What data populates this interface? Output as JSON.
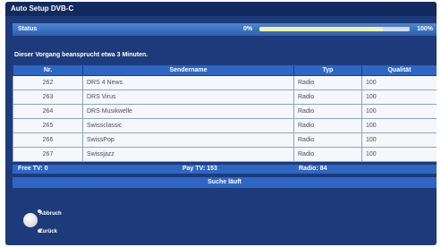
{
  "window": {
    "title": "Auto Setup DVB-C"
  },
  "status": {
    "label": "Status",
    "min_label": "0%",
    "max_label": "100%",
    "progress_fraction": 0.82
  },
  "notice": "Dieser Vorgang beansprucht etwa 3 Minuten.",
  "table": {
    "headers": [
      "Nr.",
      "Sendername",
      "Typ",
      "Qualität"
    ],
    "rows": [
      {
        "nr": "262",
        "name": "DRS 4 News",
        "type": "Radio",
        "quality": "100"
      },
      {
        "nr": "263",
        "name": "DRS Virus",
        "type": "Radio",
        "quality": "100"
      },
      {
        "nr": "264",
        "name": "DRS Musikwelle",
        "type": "Radio",
        "quality": "100"
      },
      {
        "nr": "265",
        "name": "Swissclassic",
        "type": "Radio",
        "quality": "100"
      },
      {
        "nr": "266",
        "name": "SwissPop",
        "type": "Radio",
        "quality": "100"
      },
      {
        "nr": "267",
        "name": "Swissjazz",
        "type": "Radio",
        "quality": "100"
      }
    ]
  },
  "summary": {
    "free_tv": "Free TV: 0",
    "pay_tv": "Pay TV: 153",
    "radio": "Radio: 84"
  },
  "search_status": "Suche läuft",
  "remote_hints": {
    "cancel": "Abbruch",
    "back": "Zurück"
  },
  "colors": {
    "background": "#1d3a7a",
    "accent": "#2f66c2",
    "row_background": "#f6f7fa"
  }
}
